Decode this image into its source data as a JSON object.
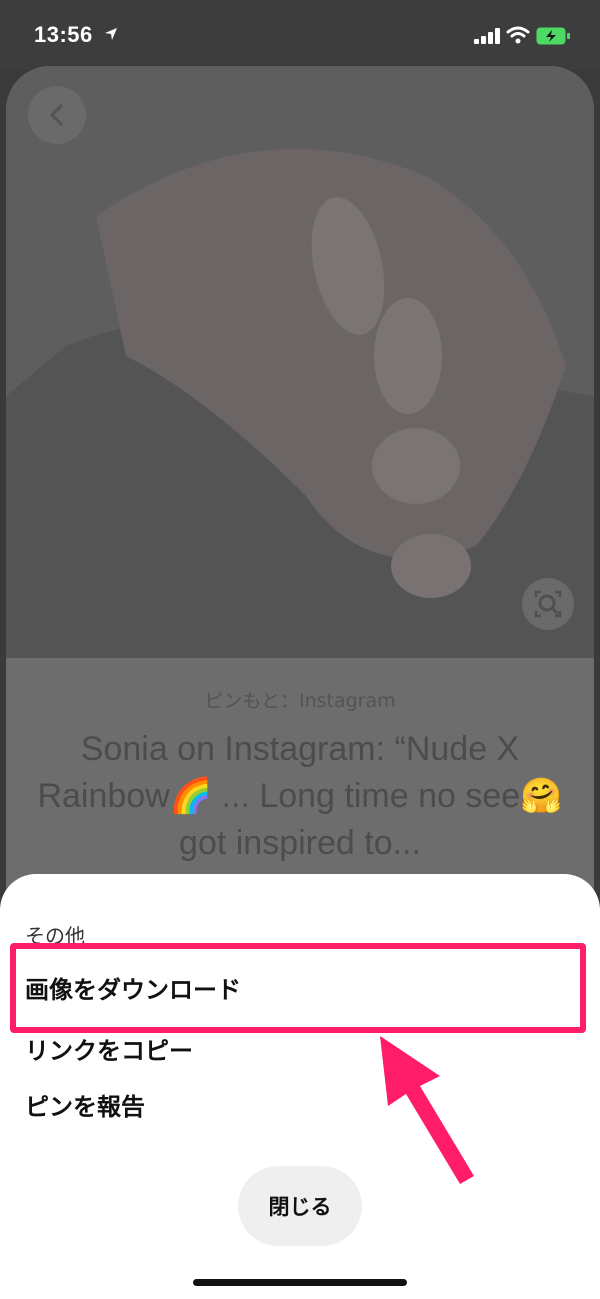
{
  "status_bar": {
    "time": "13:56"
  },
  "pin": {
    "source": "ピンもと：Instagram",
    "title": "Sonia on Instagram: “Nude X Rainbow🌈 ... Long time no see🤗 got inspired to..."
  },
  "sheet": {
    "header": "その他",
    "items": [
      {
        "label": "画像をダウンロード"
      },
      {
        "label": "リンクをコピー"
      },
      {
        "label": "ピンを報告"
      }
    ],
    "close_label": "閉じる"
  },
  "colors": {
    "highlight": "#ff1d6a",
    "overlay": "#3d3d3d",
    "sheet_bg": "#ffffff"
  },
  "icons": [
    "location-arrow-icon",
    "signal-icon",
    "wifi-icon",
    "battery-charging-icon",
    "back-chevron-icon",
    "visual-search-icon"
  ]
}
